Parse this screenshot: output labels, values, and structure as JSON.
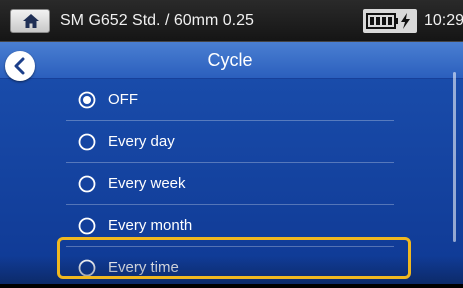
{
  "status_bar": {
    "home_icon": "home-icon",
    "title": "SM G652 Std. / 60mm 0.25",
    "battery_icon": "battery-charging-icon",
    "time": "10:29"
  },
  "header": {
    "back_icon": "chevron-left-icon",
    "title": "Cycle"
  },
  "options": [
    {
      "label": "OFF",
      "selected": true
    },
    {
      "label": "Every day",
      "selected": false
    },
    {
      "label": "Every week",
      "selected": false
    },
    {
      "label": "Every month",
      "selected": false
    },
    {
      "label": "Every time",
      "selected": false
    }
  ],
  "colors": {
    "background": "#1b4fae",
    "header": "#2b5fbd",
    "highlight": "#f0b820",
    "text": "#ffffff"
  }
}
